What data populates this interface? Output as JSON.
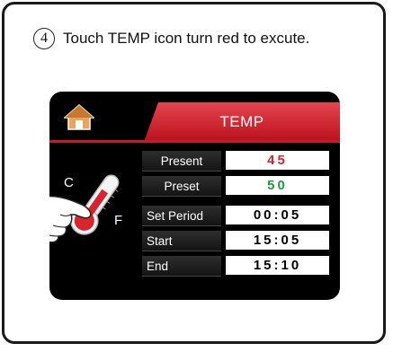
{
  "instruction": {
    "step_number": "4",
    "text": "Touch TEMP icon turn red to excute."
  },
  "screen": {
    "tab_label": "TEMP",
    "thermometer": {
      "c_label": "C",
      "f_label": "F"
    },
    "rows": [
      {
        "label": "Present",
        "value": "45",
        "value_color": "red"
      },
      {
        "label": "Preset",
        "value": "50",
        "value_color": "green"
      },
      {
        "label": "Set Period",
        "value": "00:05",
        "value_color": "black"
      },
      {
        "label": "Start",
        "value": "15:05",
        "value_color": "black"
      },
      {
        "label": "End",
        "value": "15:10",
        "value_color": "black"
      }
    ]
  },
  "colors": {
    "accent_red": "#c51c27",
    "present_value": "#d8242f",
    "preset_value": "#1f9a3c"
  }
}
